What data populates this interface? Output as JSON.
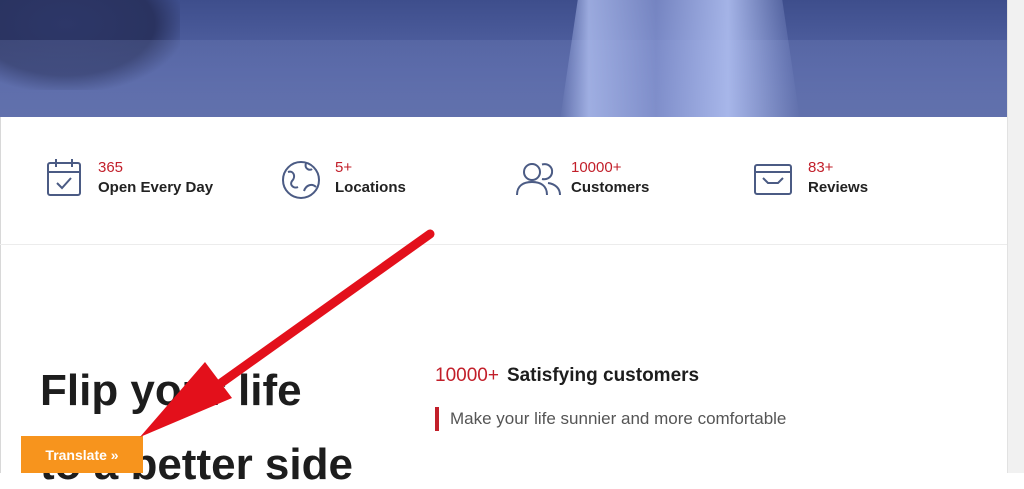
{
  "stats": [
    {
      "number": "365",
      "label": "Open Every Day",
      "icon": "calendar-check-icon"
    },
    {
      "number": "5+",
      "label": "Locations",
      "icon": "globe-icon"
    },
    {
      "number": "10000+",
      "label": "Customers",
      "icon": "users-icon"
    },
    {
      "number": "83+",
      "label": "Reviews",
      "icon": "review-card-icon"
    }
  ],
  "headline": {
    "line1": "Flip your life",
    "line2": "to a better side"
  },
  "customers": {
    "number": "10000+",
    "text": "Satisfying customers"
  },
  "tagline": "Make your life sunnier and more comfortable",
  "translate_label": "Translate »",
  "colors": {
    "accent": "#c21f2a",
    "icon": "#4b5b84",
    "translate_bg": "#f7941d",
    "annotation_arrow": "#e3101b"
  }
}
